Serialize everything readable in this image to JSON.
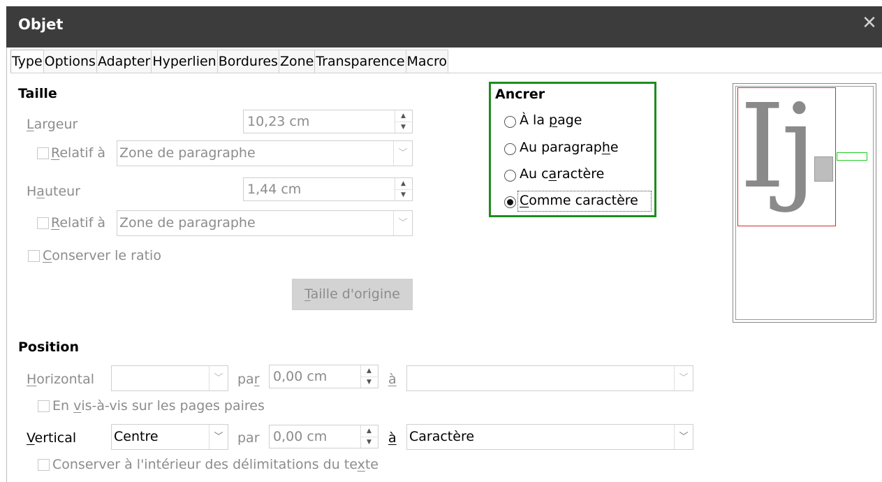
{
  "window": {
    "title": "Objet",
    "close_icon": "close-icon"
  },
  "tabs": [
    {
      "label": "Type",
      "active": true
    },
    {
      "label": "Options"
    },
    {
      "label": "Adapter"
    },
    {
      "label": "Hyperlien"
    },
    {
      "label": "Bordures"
    },
    {
      "label": "Zone"
    },
    {
      "label": "Transparence"
    },
    {
      "label": "Macro"
    }
  ],
  "taille": {
    "heading": "Taille",
    "largeur": {
      "label_pre": "",
      "label_u": "L",
      "label_post": "argeur",
      "value": "10,23 cm"
    },
    "relatif1": {
      "label_u": "R",
      "label_post": "elatif à",
      "value": "Zone de paragraphe"
    },
    "hauteur": {
      "label_pre": "H",
      "label_u": "a",
      "label_post": "uteur",
      "value": "1,44 cm"
    },
    "relatif2": {
      "label_u": "R",
      "label_post": "elatif à",
      "value": "Zone de paragraphe"
    },
    "ratio": {
      "label_u": "C",
      "label_post": "onserver le ratio"
    },
    "origin_button": {
      "label_u": "T",
      "label_post": "aille d'origine"
    }
  },
  "ancrer": {
    "heading": "Ancrer",
    "options": [
      {
        "pre": "À la ",
        "u": "p",
        "post": "age",
        "checked": false
      },
      {
        "pre": "Au paragrap",
        "u": "h",
        "post": "e",
        "checked": false
      },
      {
        "pre": "Au c",
        "u": "a",
        "post": "ractère",
        "checked": false
      },
      {
        "pre": "",
        "u": "C",
        "post": "omme caractère",
        "checked": true
      }
    ]
  },
  "preview": {
    "glyphs": "Ij"
  },
  "position": {
    "heading": "Position",
    "horizontal": {
      "label_u": "H",
      "label_post": "orizontal",
      "combo_value": "",
      "par_pre": "pa",
      "par_u": "r",
      "par_value": "0,00 cm",
      "a_label": "à",
      "a_value": ""
    },
    "vis": {
      "pre": "En ",
      "u": "v",
      "post": "is-à-vis sur les pages paires"
    },
    "vertical": {
      "label_u": "V",
      "label_post": "ertical",
      "combo_value": "Centre",
      "par_label": "par",
      "par_value": "0,00 cm",
      "a_label": "à",
      "a_value": "Caractère"
    },
    "keep": {
      "pre": "Conserver à l'intérieur des délimitations du te",
      "u": "x",
      "post": "te"
    }
  }
}
